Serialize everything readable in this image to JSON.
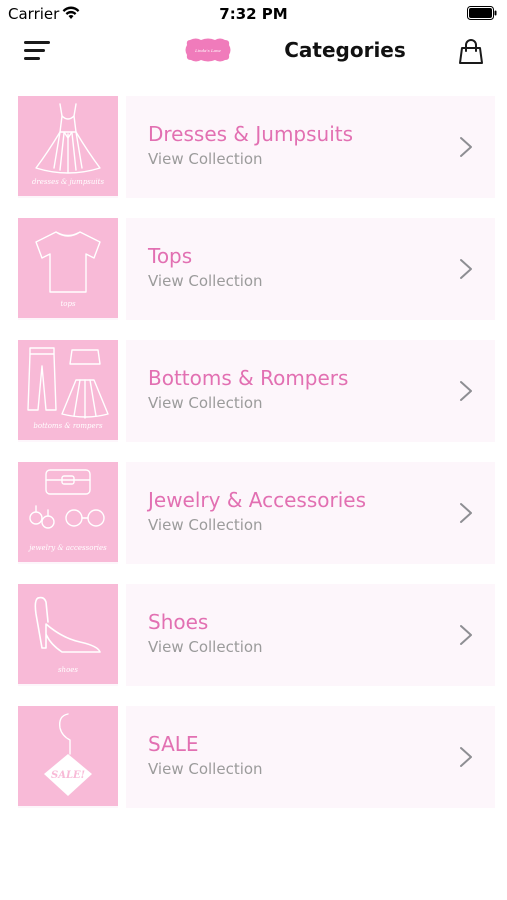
{
  "status_bar": {
    "carrier": "Carrier",
    "time": "7:32 PM"
  },
  "nav": {
    "title": "Categories",
    "logo_text": "Linda's Lane"
  },
  "categories": [
    {
      "title": "Dresses & Jumpsuits",
      "subtitle": "View Collection",
      "caption": "dresses & jumpsuits",
      "icon": "dress-icon"
    },
    {
      "title": "Tops",
      "subtitle": "View Collection",
      "caption": "tops",
      "icon": "shirt-icon"
    },
    {
      "title": "Bottoms & Rompers",
      "subtitle": "View Collection",
      "caption": "bottoms & rompers",
      "icon": "pants-skirt-icon"
    },
    {
      "title": "Jewelry & Accessories",
      "subtitle": "View Collection",
      "caption": "jewelry & accessories",
      "icon": "jewelry-icon"
    },
    {
      "title": "Shoes",
      "subtitle": "View Collection",
      "caption": "shoes",
      "icon": "high-heel-icon"
    },
    {
      "title": "SALE",
      "subtitle": "View Collection",
      "caption": "SALE!",
      "icon": "sale-tag-icon"
    }
  ],
  "colors": {
    "accent_pink": "#e270b2",
    "thumb_pink": "#f8bad7",
    "row_bg": "#fdf6fb",
    "subtitle_gray": "#9b9b9b"
  }
}
